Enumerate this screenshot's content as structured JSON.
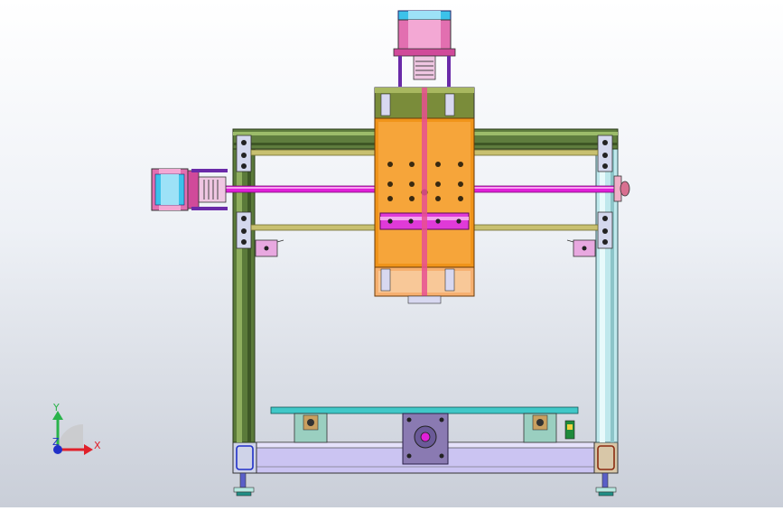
{
  "triad": {
    "x_label": "X",
    "y_label": "Y",
    "z_label": "Z",
    "x_color": "#e0202a",
    "y_color": "#29b34a",
    "z_color": "#2030c8"
  },
  "colors": {
    "background_top": "#ffffff",
    "background_bottom": "#c9ced8",
    "frame_green": "#5b7a3a",
    "frame_cyan": "#bfe8ec",
    "carriage_orange": "#f0941a",
    "rod_magenta": "#e020d8",
    "rod_olive": "#c8c070",
    "motor_pink": "#e26fb0",
    "motor_blue": "#29b3e6",
    "base_lavender": "#c8c0f0",
    "bed_teal": "#40c8c8"
  }
}
